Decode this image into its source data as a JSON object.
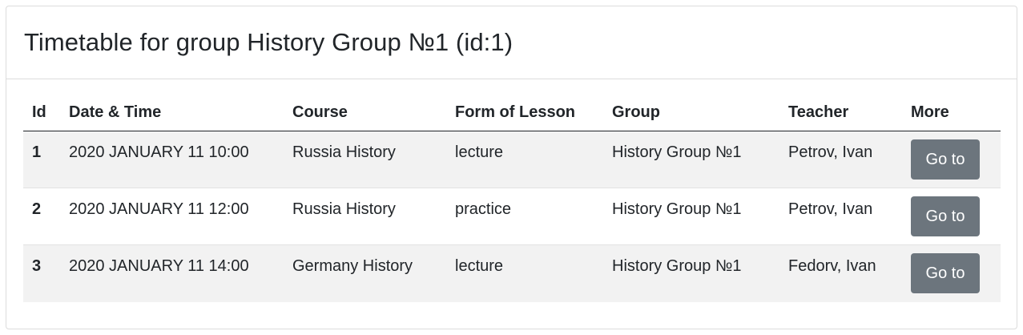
{
  "header": {
    "title": "Timetable for group History Group №1 (id:1)"
  },
  "table": {
    "columns": [
      "Id",
      "Date & Time",
      "Course",
      "Form of Lesson",
      "Group",
      "Teacher",
      "More"
    ],
    "rows": [
      {
        "id": "1",
        "datetime": "2020 JANUARY 11 10:00",
        "course": "Russia History",
        "form": "lecture",
        "group": "History Group №1",
        "teacher": "Petrov, Ivan",
        "button": "Go to"
      },
      {
        "id": "2",
        "datetime": "2020 JANUARY 11 12:00",
        "course": "Russia History",
        "form": "practice",
        "group": "History Group №1",
        "teacher": "Petrov, Ivan",
        "button": "Go to"
      },
      {
        "id": "3",
        "datetime": "2020 JANUARY 11 14:00",
        "course": "Germany History",
        "form": "lecture",
        "group": "History Group №1",
        "teacher": "Fedorv, Ivan",
        "button": "Go to"
      }
    ]
  },
  "colors": {
    "button_bg": "#6c757d",
    "stripe_bg": "#f2f2f2",
    "text": "#212529"
  }
}
